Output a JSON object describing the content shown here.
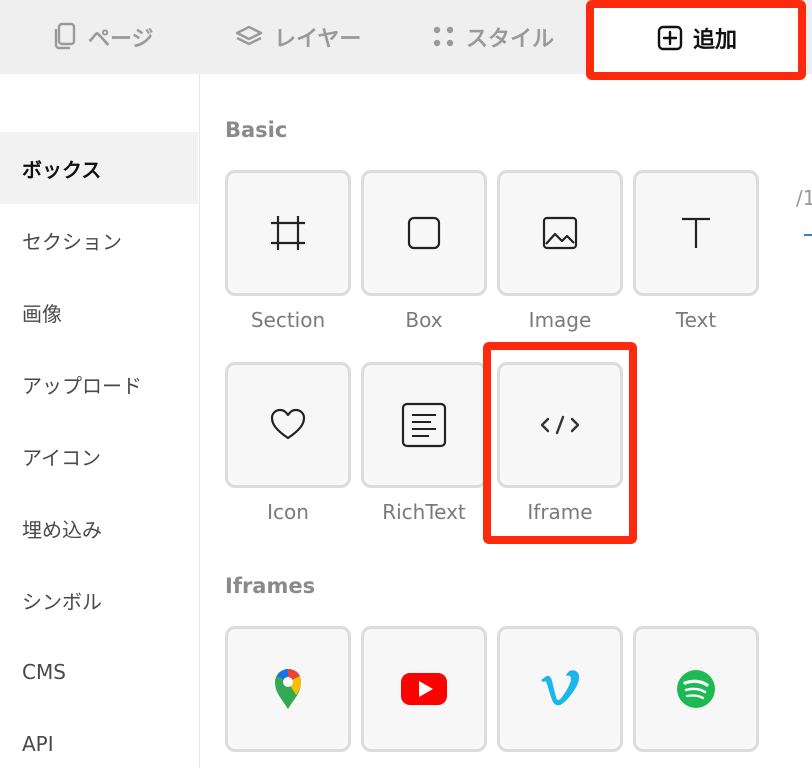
{
  "tabs": [
    {
      "label": "ページ",
      "icon": "pages-icon"
    },
    {
      "label": "レイヤー",
      "icon": "layers-icon"
    },
    {
      "label": "スタイル",
      "icon": "styles-icon"
    },
    {
      "label": "追加",
      "icon": "add-square-icon",
      "active": true
    }
  ],
  "sidebar": {
    "items": [
      {
        "label": "ボックス",
        "active": true
      },
      {
        "label": "セクション"
      },
      {
        "label": "画像"
      },
      {
        "label": "アップロード"
      },
      {
        "label": "アイコン"
      },
      {
        "label": "埋め込み"
      },
      {
        "label": "シンボル"
      },
      {
        "label": "CMS"
      },
      {
        "label": "API"
      }
    ]
  },
  "basic": {
    "title": "Basic",
    "tiles": [
      {
        "label": "Section",
        "icon": "crop-frame-icon"
      },
      {
        "label": "Box",
        "icon": "square-icon"
      },
      {
        "label": "Image",
        "icon": "image-icon"
      },
      {
        "label": "Text",
        "icon": "text-t-icon"
      },
      {
        "label": "Icon",
        "icon": "heart-icon"
      },
      {
        "label": "RichText",
        "icon": "rich-text-icon"
      },
      {
        "label": "Iframe",
        "icon": "code-icon"
      }
    ]
  },
  "iframes": {
    "title": "Iframes",
    "tiles": [
      {
        "icon": "google-maps-icon"
      },
      {
        "icon": "youtube-icon"
      },
      {
        "icon": "vimeo-icon"
      },
      {
        "icon": "spotify-icon"
      }
    ]
  },
  "colors": {
    "highlight": "#ff2a0d",
    "youtube": "#ff0000",
    "vimeo": "#1ab7ea",
    "spotify": "#1db954"
  },
  "edge_fragment": "/1"
}
